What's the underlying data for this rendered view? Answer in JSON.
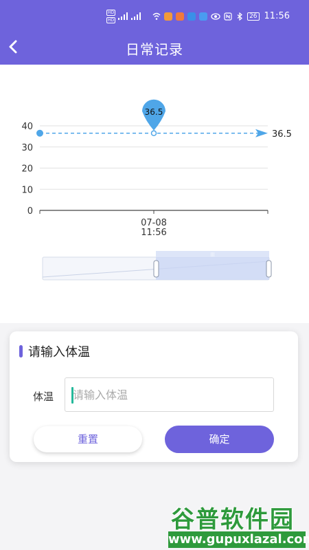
{
  "status_bar": {
    "network_labels": [
      "HD",
      "HD"
    ],
    "signal_labels": [
      "5G",
      "4G"
    ],
    "battery": "26",
    "time": "11:56"
  },
  "header": {
    "title": "日常记录",
    "back_icon": "chevron-left-icon"
  },
  "chart_data": {
    "type": "line",
    "x": [
      "07-08\n11:56"
    ],
    "x_tick_labels": [
      {
        "date": "07-08",
        "time": "11:56"
      }
    ],
    "series": [
      {
        "values": [
          36.5
        ]
      }
    ],
    "marker_label": "36.5",
    "end_label": "36.5",
    "y_ticks": [
      0,
      10,
      20,
      30,
      40
    ],
    "ylim": [
      0,
      40
    ],
    "grid": true,
    "colors": {
      "line": "#4fa6e8",
      "grid": "#e2e2e2",
      "axis": "#444444",
      "zoom_fill": "#c8d4f4"
    },
    "zoom_range": [
      0.5,
      1.0
    ]
  },
  "form": {
    "title": "请输入体温",
    "field_label": "体温",
    "field_placeholder": "请输入体温",
    "field_value": "",
    "reset_label": "重置",
    "confirm_label": "确定"
  },
  "watermark": {
    "title": "谷普软件园",
    "url": "www.gupuxlazal.com"
  }
}
